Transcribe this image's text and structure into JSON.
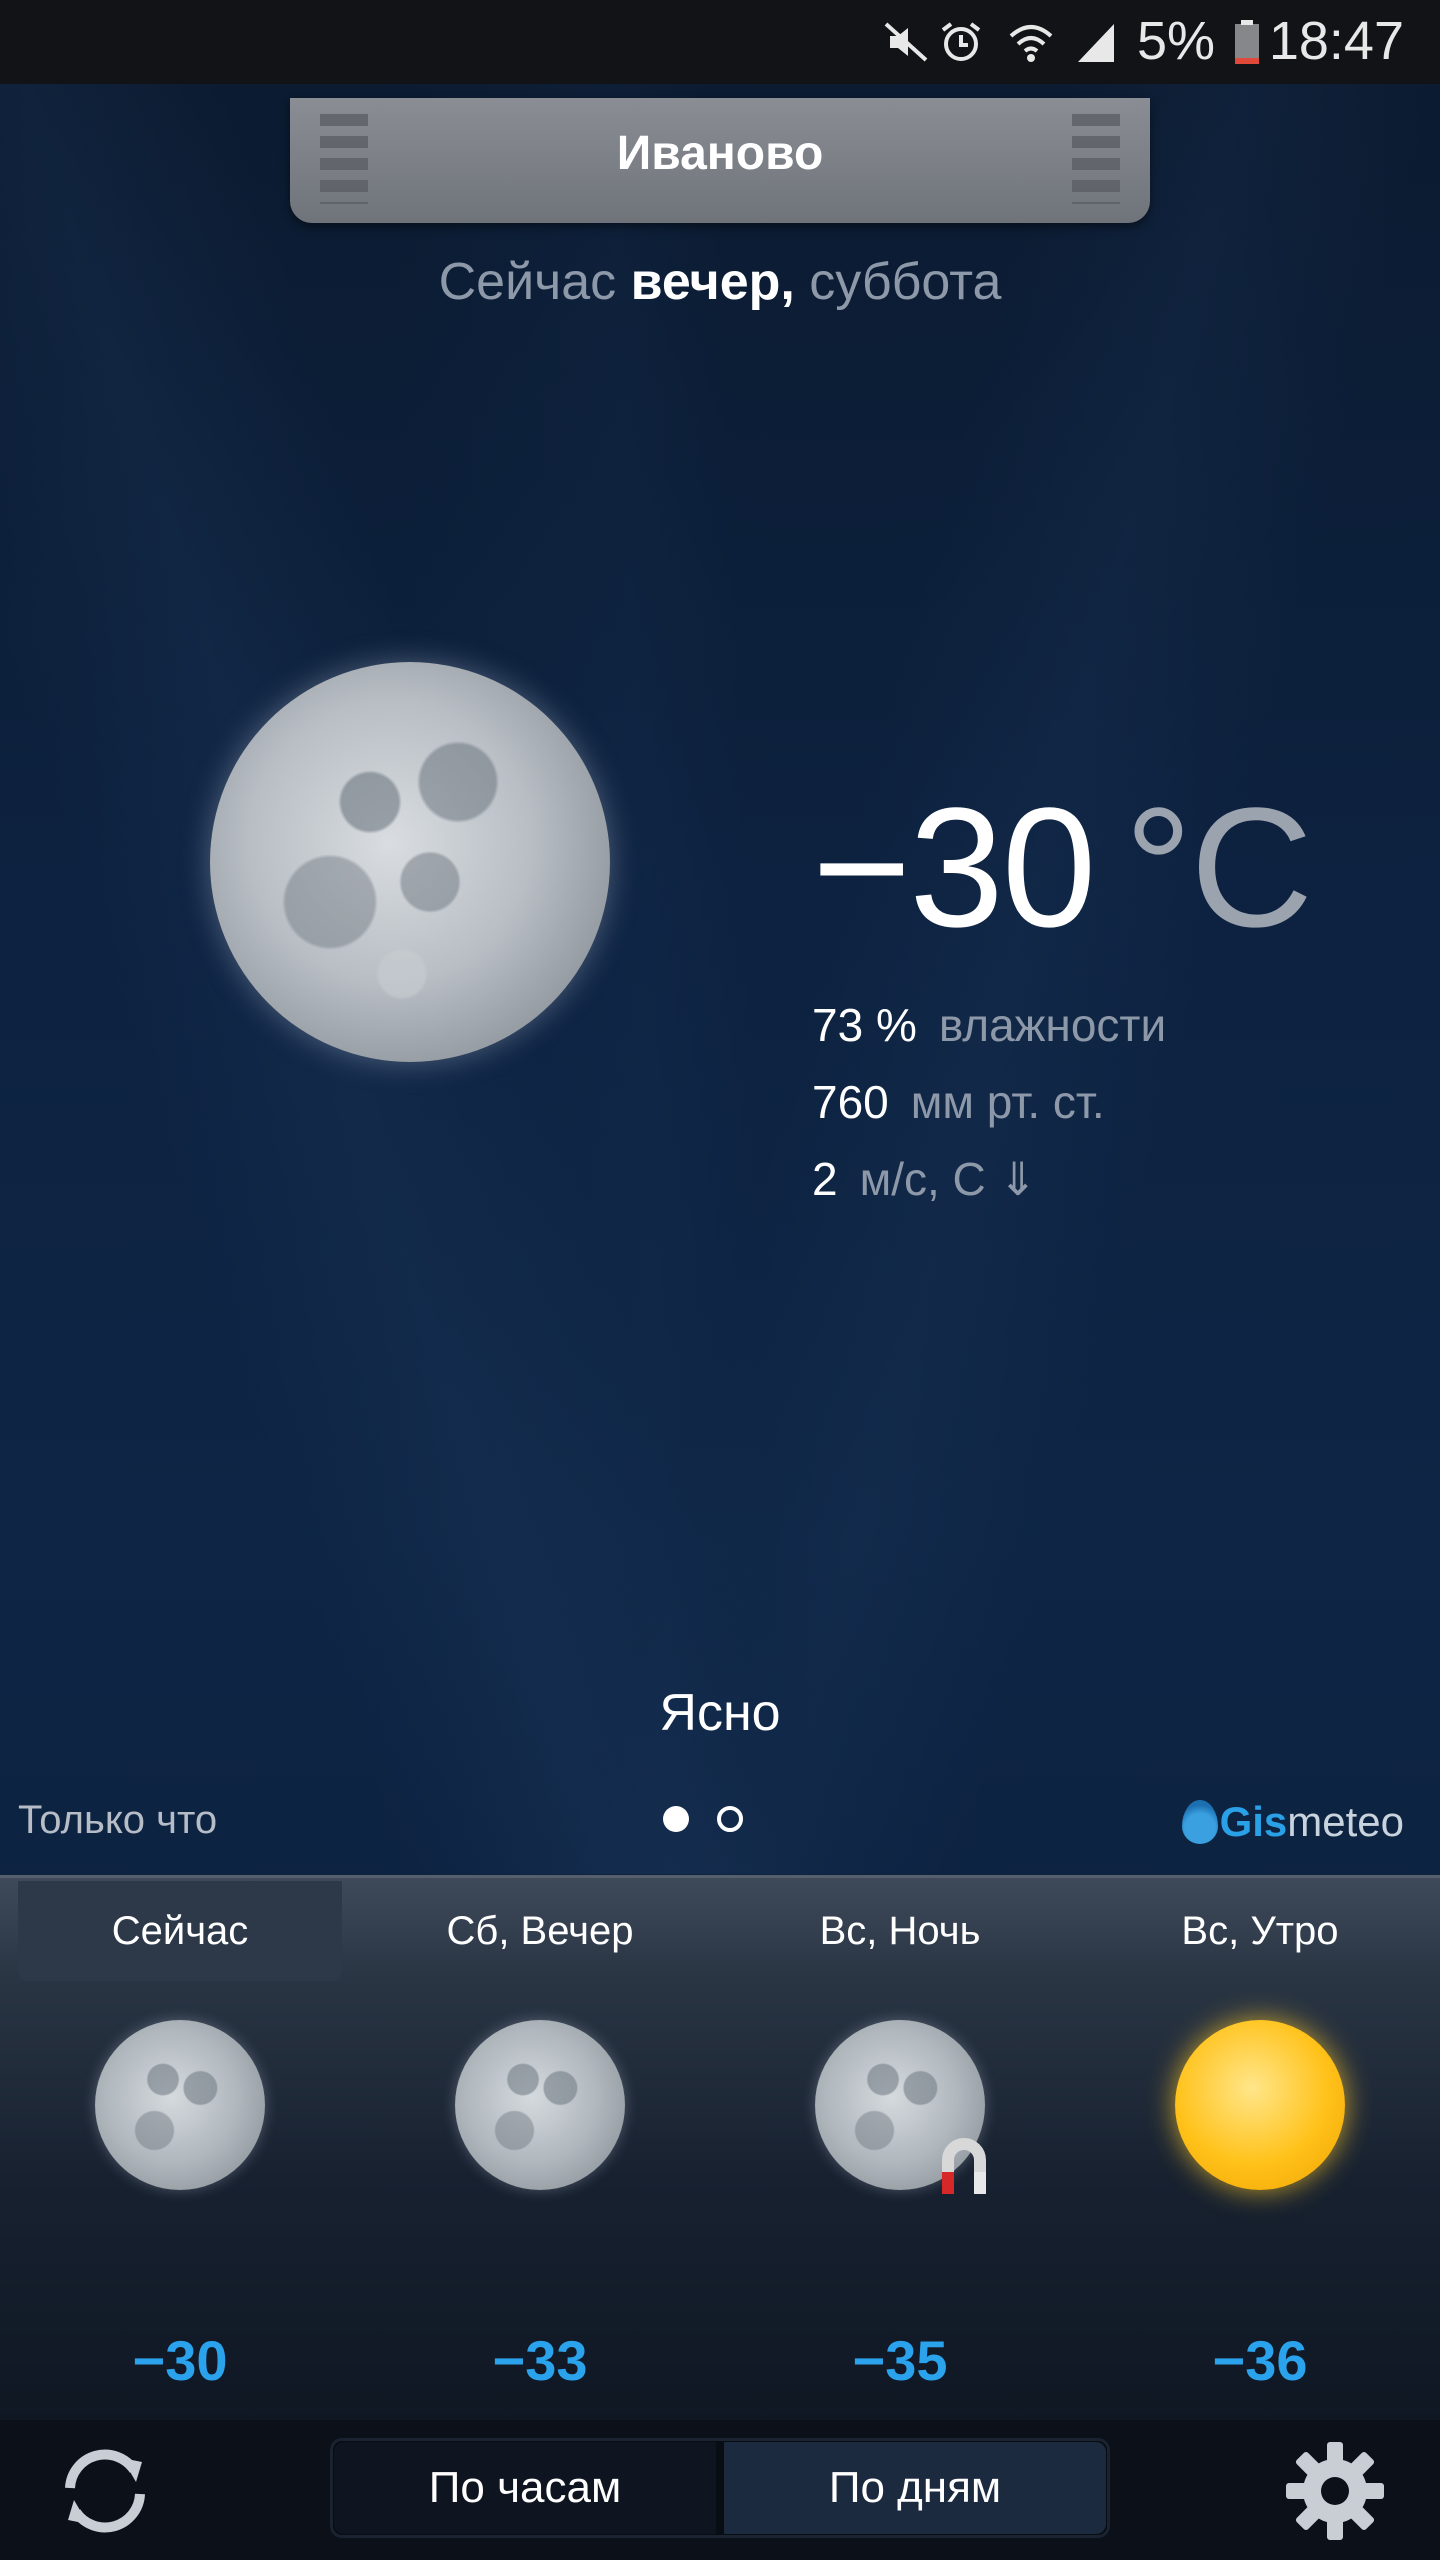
{
  "status_bar": {
    "battery": "5%",
    "time": "18:47",
    "icons": [
      "mute-icon",
      "alarm-icon",
      "wifi-icon",
      "signal-icon",
      "battery-icon"
    ]
  },
  "city": "Иваново",
  "subtitle": {
    "prefix": "Сейчас",
    "period": "вечер,",
    "day": "суббота"
  },
  "current": {
    "temperature": "−30",
    "unit": "°C",
    "humidity_value": "73 %",
    "humidity_label": "влажности",
    "pressure_value": "760",
    "pressure_label": "мм рт. ст.",
    "wind_value": "2",
    "wind_label": "м/с, С ⇓",
    "condition": "Ясно"
  },
  "updated": "Только что",
  "pager": {
    "pages": 2,
    "active": 1
  },
  "brand": {
    "part1": "Gis",
    "part2": "meteo"
  },
  "forecast": [
    {
      "label": "Сейчас",
      "icon": "moon-icon",
      "temp": "−30",
      "selected": true
    },
    {
      "label": "Сб, Вечер",
      "icon": "moon-icon",
      "temp": "−33",
      "selected": false
    },
    {
      "label": "Вс, Ночь",
      "icon": "moon-magnet-icon",
      "temp": "−35",
      "selected": false
    },
    {
      "label": "Вс, Утро",
      "icon": "sun-icon",
      "temp": "−36",
      "selected": false
    }
  ],
  "bottom": {
    "hourly": "По часам",
    "daily": "По дням",
    "active": "daily"
  },
  "colors": {
    "accent_blue": "#2aa3ec",
    "background": "#0d2240"
  }
}
